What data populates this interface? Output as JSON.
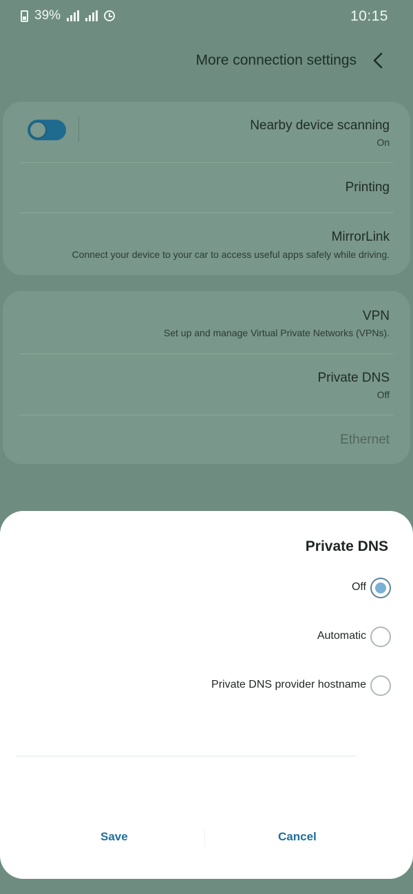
{
  "status_bar": {
    "time": "10:15",
    "battery_text": "39%"
  },
  "header": {
    "title": "More connection settings",
    "back_icon": "chevron-left-icon"
  },
  "settings": {
    "group1": [
      {
        "title": "Nearby device scanning",
        "subtitle": "On",
        "toggle": true
      },
      {
        "title": "Printing"
      },
      {
        "title": "MirrorLink",
        "subtitle": "Connect your device to your car to access useful apps safely while driving."
      }
    ],
    "group2": [
      {
        "title": "VPN",
        "subtitle": "Set up and manage Virtual Private Networks (VPNs)."
      },
      {
        "title": "Private DNS",
        "subtitle": "Off"
      },
      {
        "title": "Ethernet"
      }
    ]
  },
  "dialog": {
    "title": "Private DNS",
    "options": [
      {
        "label": "Off",
        "checked": true
      },
      {
        "label": "Automatic",
        "checked": false
      },
      {
        "label": "Private DNS provider hostname",
        "checked": false
      }
    ],
    "cancel_label": "Cancel",
    "save_label": "Save"
  },
  "colors": {
    "accent": "#1f6f9a",
    "dim_background": "#6e8d80",
    "card": "#79978a",
    "toggle_on": "#1f6b8f"
  }
}
